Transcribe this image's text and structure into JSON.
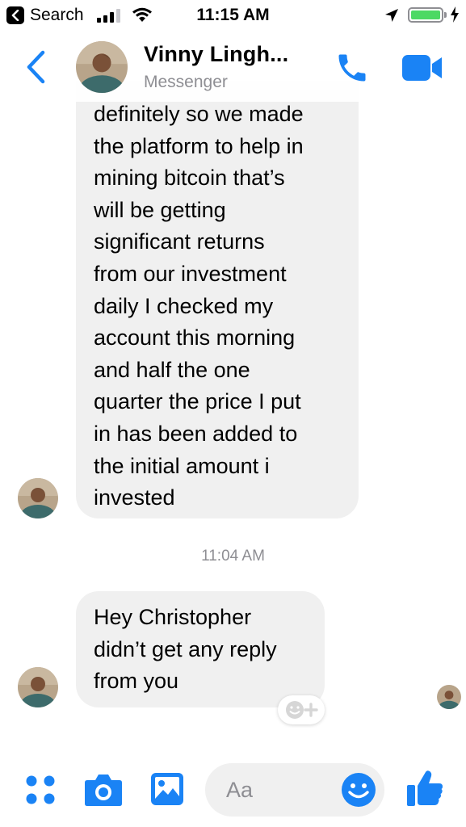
{
  "status_bar": {
    "back_app": "Search",
    "time": "11:15 AM",
    "battery_percent": 100
  },
  "header": {
    "contact_name": "Vinny Lingh...",
    "subtitle": "Messenger",
    "back_icon": "chevron-left-icon",
    "call_icon": "phone-icon",
    "video_icon": "video-camera-icon",
    "accent_color": "#1a83f5"
  },
  "messages": [
    {
      "sender": "contact",
      "lines": [
        "definitely so we made",
        "the platform to help in",
        "mining bitcoin that’s",
        "will be getting",
        "significant returns",
        "from our investment",
        "daily I checked my",
        "account this morning",
        "and half the one",
        "quarter the price I put",
        "in has been added to",
        "the initial amount i",
        "invested"
      ]
    },
    {
      "sender": "contact",
      "timestamp": "11:04 AM",
      "lines": [
        "Hey Christopher",
        "didn’t get any reply",
        "from you"
      ]
    }
  ],
  "composer": {
    "placeholder": "Aa",
    "apps_icon": "apps-grid-icon",
    "camera_icon": "camera-icon",
    "gallery_icon": "gallery-icon",
    "emoji_icon": "smiley-icon",
    "like_icon": "thumbs-up-icon"
  },
  "colors": {
    "bubble_bg": "#f0f0f0",
    "accent": "#1a83f5",
    "secondary_text": "#8e8e93"
  }
}
